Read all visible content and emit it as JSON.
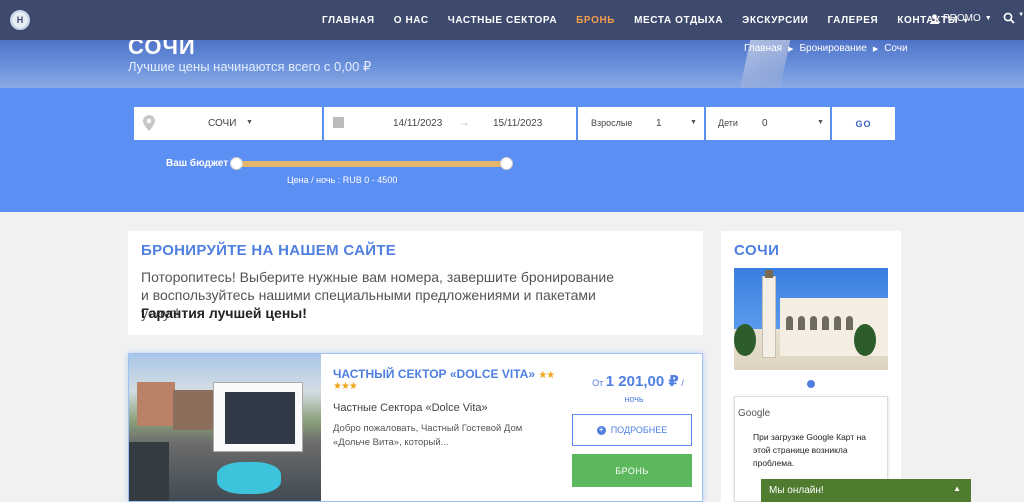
{
  "nav": {
    "logo_text": "H",
    "items": [
      {
        "label": "ГЛАВНАЯ"
      },
      {
        "label": "О НАС"
      },
      {
        "label": "ЧАСТНЫЕ СЕКТОРА"
      },
      {
        "label": "БРОНЬ",
        "active": true
      },
      {
        "label": "МЕСТА ОТДЫХА"
      },
      {
        "label": "ЭКСКУРСИИ"
      },
      {
        "label": "ГАЛЕРЕЯ"
      },
      {
        "label": "КОНТАКТЫ"
      }
    ],
    "promo_label": "PROMO",
    "colors": {
      "background": "#3e4a6d",
      "active": "#f39c4a"
    }
  },
  "hero": {
    "title": "СОЧИ",
    "subtitle": "Лучшие цены начинаются всего с 0,00 ₽",
    "breadcrumb": [
      "Главная",
      "Бронирование",
      "Сочи"
    ]
  },
  "search": {
    "city": "СОЧИ",
    "date_from": "14/11/2023",
    "date_to": "15/11/2023",
    "adults_label": "Взрослые",
    "adults_value": "1",
    "kids_label": "Дети",
    "kids_value": "0",
    "go_label": "GO",
    "budget_label": "Ваш бюджет",
    "budget_range": "Цена / ночь : RUB  0 - 4500",
    "budget_min_fraction": 0,
    "budget_max_fraction": 1,
    "band_color": "#5b8ff3"
  },
  "promo": {
    "title": "БРОНИРУЙТЕ НА НАШЕМ САЙТЕ",
    "text": "Поторопитесь! Выберите нужные вам номера, завершите бронирование и воспользуйтесь нашими специальными предложениями и пакетами услуг!",
    "strong": "Гарантия лучшей цены!"
  },
  "hotel": {
    "name": "ЧАСТНЫЙ СЕКТОР «DOLCE VITA»",
    "stars_inline": "★★",
    "stars_line2": "★★★",
    "type": "Частные Сектора «Dolce Vita»",
    "description": "Добро пожаловать, Частный Гостевой Дом «Дольче Вита», который...",
    "price_prefix": "От",
    "price": "1 201,00 ₽",
    "price_suffix": "/",
    "per_night": "ночь",
    "more_label": "ПОДРОБНЕЕ",
    "book_label": "БРОНЬ",
    "book_color": "#5cb85c"
  },
  "sidebar": {
    "title": "СОЧИ",
    "map_brand": "Google",
    "map_message": "При загрузке Google Карт на этой странице возникла проблема."
  },
  "chat": {
    "label": "Мы онлайн!",
    "color": "#4f7c2f"
  }
}
